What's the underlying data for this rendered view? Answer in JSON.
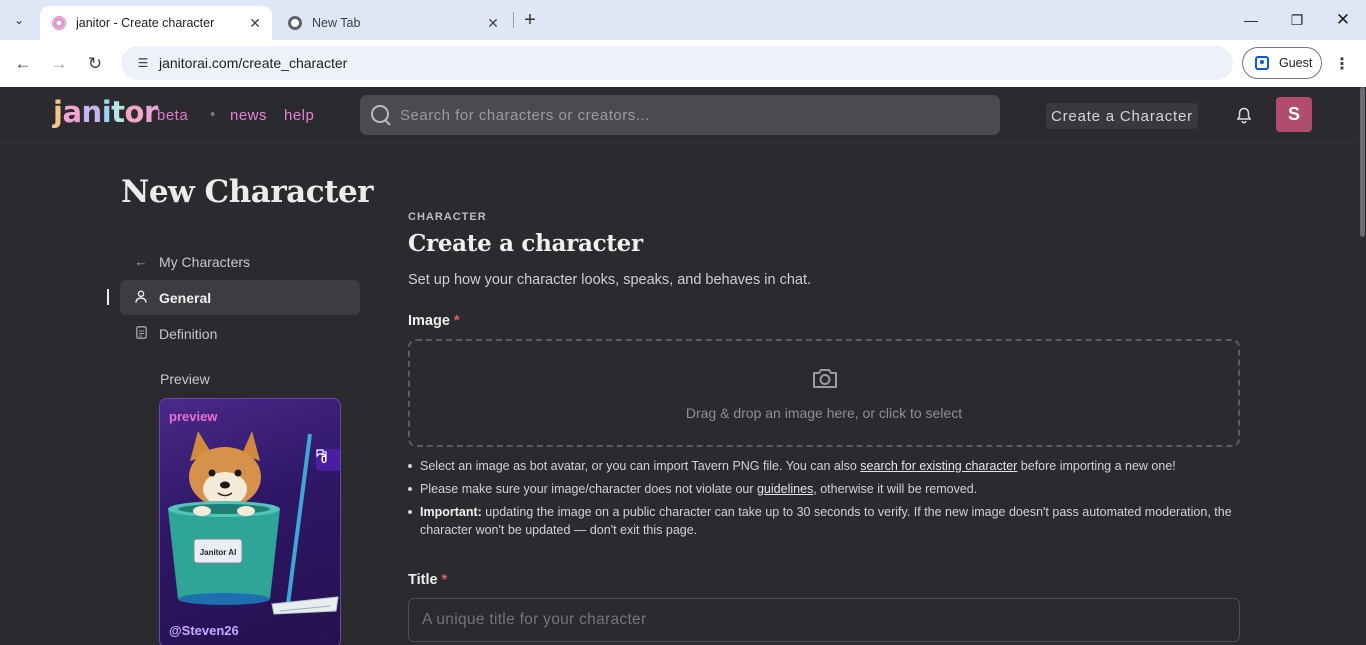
{
  "browser": {
    "tabs": [
      {
        "title": "janitor - Create character",
        "active": true
      },
      {
        "title": "New Tab",
        "active": false
      }
    ],
    "url": "janitorai.com/create_character",
    "profile_label": "Guest"
  },
  "header": {
    "logo": "janitor",
    "beta": "beta",
    "nav": {
      "news": "news",
      "help": "help"
    },
    "search_placeholder": "Search for characters or creators...",
    "create_button": "Create a Character",
    "avatar_initial": "S"
  },
  "sidebar": {
    "page_title": "New Character",
    "items": [
      {
        "label": "My Characters",
        "icon": "arrow-left-icon"
      },
      {
        "label": "General",
        "icon": "user-icon",
        "active": true
      },
      {
        "label": "Definition",
        "icon": "document-icon"
      }
    ],
    "preview_label": "Preview",
    "preview_card": {
      "tag": "preview",
      "badge": "0",
      "username": "@Steven26",
      "bucket_label": "Janitor AI"
    }
  },
  "main": {
    "eyebrow": "CHARACTER",
    "heading": "Create a character",
    "subheading": "Set up how your character looks, speaks, and behaves in chat.",
    "image_label": "Image",
    "required_mark": "*",
    "dropzone_text": "Drag & drop an image here, or click to select",
    "hints": {
      "h1_pre": "Select an image as bot avatar, or you can import Tavern PNG file. You can also ",
      "h1_link": "search for existing character",
      "h1_post": " before importing a new one!",
      "h2_pre": "Please make sure your image/character does not violate our ",
      "h2_link": "guidelines",
      "h2_post": ", otherwise it will be removed.",
      "h3_bold": "Important:",
      "h3_text": " updating the image on a public character can take up to 30 seconds to verify. If the new image doesn't pass automated moderation, the character won't be updated — don't exit this page."
    },
    "title_label": "Title",
    "title_placeholder": "A unique title for your character"
  },
  "colors": {
    "accent_pink": "#ea7fd6",
    "avatar_bg": "#b04d6c",
    "required": "#e5556a",
    "background": "#2b2b2f"
  }
}
